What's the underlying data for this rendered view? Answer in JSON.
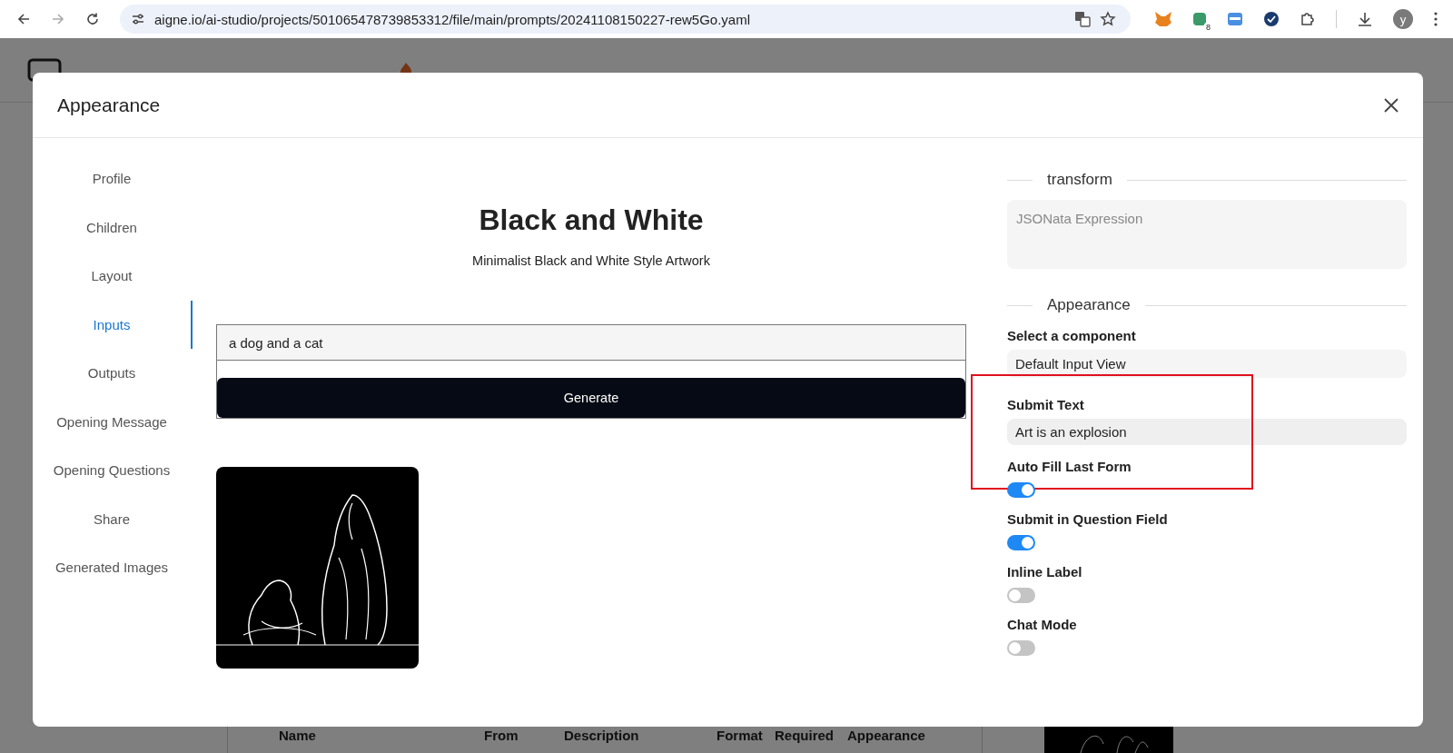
{
  "browser": {
    "url": "aigne.io/ai-studio/projects/501065478739853312/file/main/prompts/20241108150227-rew5Go.yaml",
    "forward_disabled": true,
    "extension_badge": "8",
    "profile_initial": "y"
  },
  "background_page": {
    "table_columns": [
      "Name",
      "From",
      "Description",
      "Format",
      "Required",
      "Appearance"
    ]
  },
  "dialog": {
    "title": "Appearance",
    "tabs": [
      {
        "label": "Profile",
        "selected": false
      },
      {
        "label": "Children",
        "selected": false
      },
      {
        "label": "Layout",
        "selected": false
      },
      {
        "label": "Inputs",
        "selected": true
      },
      {
        "label": "Outputs",
        "selected": false
      },
      {
        "label": "Opening Message",
        "selected": false
      },
      {
        "label": "Opening Questions",
        "selected": false
      },
      {
        "label": "Share",
        "selected": false
      },
      {
        "label": "Generated Images",
        "selected": false
      }
    ],
    "preview": {
      "title": "Black and White",
      "subtitle": "Minimalist Black and White Style Artwork",
      "input_value": "a dog and a cat",
      "button": "Generate"
    },
    "transform": {
      "heading": "transform",
      "placeholder": "JSONata Expression"
    },
    "appearance": {
      "heading": "Appearance",
      "rows": [
        {
          "kind": "label",
          "text": "Select a component"
        },
        {
          "kind": "select",
          "value": "Default Input View"
        },
        {
          "kind": "label",
          "text": "Submit Text",
          "highlighted": true
        },
        {
          "kind": "input",
          "value": "Art is an explosion",
          "highlighted": true
        },
        {
          "kind": "label",
          "text": "Auto Fill Last Form",
          "highlighted": true
        },
        {
          "kind": "switch",
          "on": true
        },
        {
          "kind": "label",
          "text": "Submit in Question Field"
        },
        {
          "kind": "switch",
          "on": true
        },
        {
          "kind": "label",
          "text": "Inline Label"
        },
        {
          "kind": "switch",
          "on": false
        },
        {
          "kind": "label",
          "text": "Chat Mode"
        },
        {
          "kind": "switch",
          "on": false
        }
      ]
    }
  }
}
